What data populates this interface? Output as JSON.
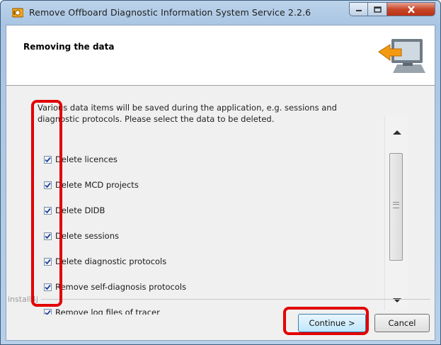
{
  "window": {
    "title": "Remove Offboard Diagnostic Information System Service 2.2.6",
    "icon": "app-installer-icon",
    "controls": [
      "minimize-icon",
      "maximize-icon",
      "close-icon"
    ]
  },
  "header": {
    "title": "Removing the data",
    "image": "computer-remove-arrow-icon"
  },
  "intro_text": "Various data items will be saved during the application, e.g. sessions and diagnostic protocols. Please select the data to be deleted.",
  "checklist": {
    "items": [
      {
        "label": "Delete licences",
        "checked": true
      },
      {
        "label": "Delete MCD projects",
        "checked": true
      },
      {
        "label": "Delete DIDB",
        "checked": true
      },
      {
        "label": "Delete sessions",
        "checked": true
      },
      {
        "label": "Delete diagnostic protocols",
        "checked": true
      },
      {
        "label": "Remove self-diagnosis protocols",
        "checked": true
      },
      {
        "label": "Remove log files of tracer",
        "checked": true
      }
    ]
  },
  "footer": {
    "brand": "install4j",
    "continue_label": "Continue >",
    "cancel_label": "Cancel"
  },
  "colors": {
    "annotation": "#e20000",
    "titlebar": "#a9c5e3",
    "close_button": "#c9472a"
  }
}
